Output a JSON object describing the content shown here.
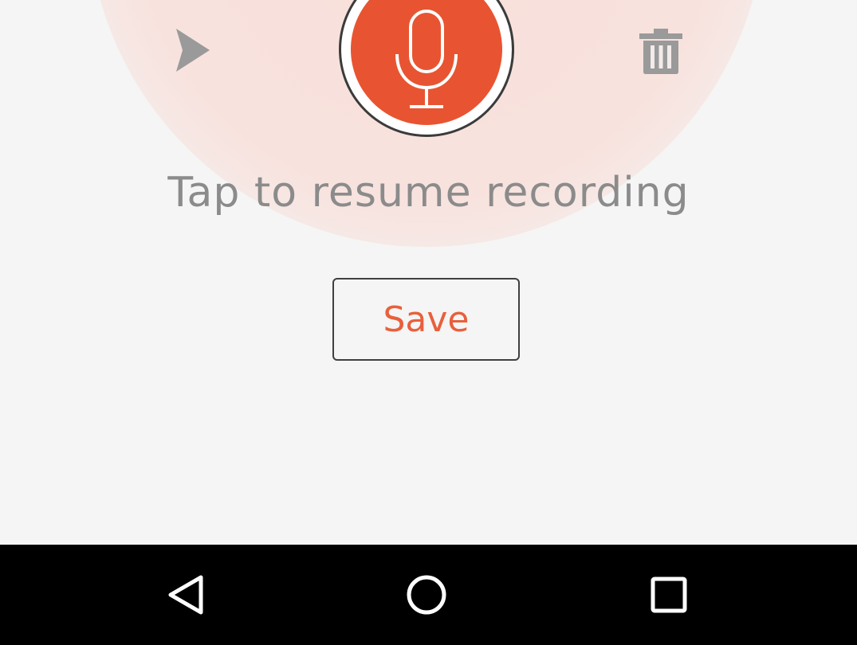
{
  "recorder": {
    "prompt": "Tap to resume recording",
    "save_label": "Save",
    "icons": {
      "play": "play-icon",
      "microphone": "microphone-icon",
      "trash": "trash-icon"
    },
    "colors": {
      "accent": "#e85431",
      "save_text": "#e8603c",
      "prompt_text": "#8b8b8b",
      "icon_gray": "#9a9a9a",
      "background": "#f4f5f4"
    }
  },
  "system_nav": {
    "icons": {
      "back": "back-triangle-icon",
      "home": "home-circle-icon",
      "recents": "recents-square-icon"
    },
    "color": "#000000"
  }
}
